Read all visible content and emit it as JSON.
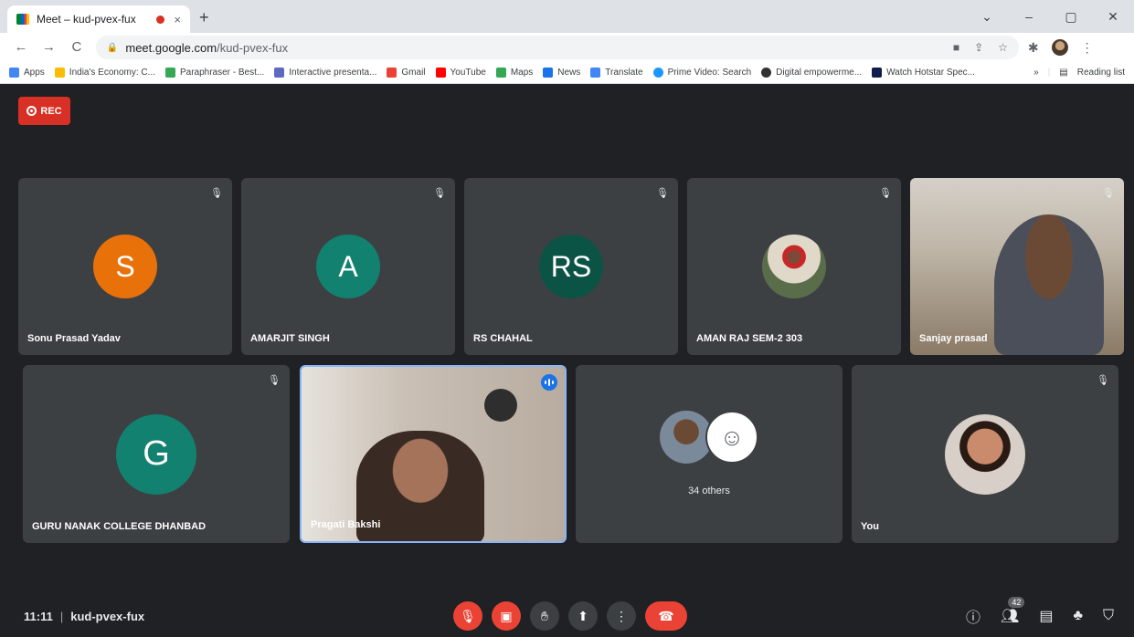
{
  "browser": {
    "tab_title": "Meet – kud-pvex-fux",
    "tab_close": "×",
    "new_tab": "+",
    "window_controls": [
      "⌄",
      "–",
      "▢",
      "✕"
    ],
    "nav": [
      "←",
      "→",
      "C"
    ],
    "url_host": "meet.google.com",
    "url_path": "/kud-pvex-fux",
    "bookmarks": [
      {
        "label": "Apps",
        "color": "#4285f4"
      },
      {
        "label": "India's Economy: C...",
        "color": "#fbbc04"
      },
      {
        "label": "Paraphraser - Best...",
        "color": "#34a853"
      },
      {
        "label": "Interactive presenta...",
        "color": "#5c6bc0"
      },
      {
        "label": "Gmail",
        "color": "#ea4335"
      },
      {
        "label": "YouTube",
        "color": "#ff0000"
      },
      {
        "label": "Maps",
        "color": "#34a853"
      },
      {
        "label": "News",
        "color": "#1a73e8"
      },
      {
        "label": "Translate",
        "color": "#4285f4"
      },
      {
        "label": "Prime Video: Search",
        "color": "#1a98ff"
      },
      {
        "label": "Digital empowerme...",
        "color": "#333333"
      },
      {
        "label": "Watch Hotstar Spec...",
        "color": "#0f1c4d"
      }
    ],
    "more": "»",
    "reading_list": "Reading list"
  },
  "meet": {
    "rec_label": "REC",
    "participants": [
      {
        "name": "Sonu Prasad Yadav",
        "initials": "S",
        "color": "#e8710a"
      },
      {
        "name": "AMARJIT SINGH",
        "initials": "A",
        "color": "#12816f"
      },
      {
        "name": "RS CHAHAL",
        "initials": "RS",
        "color": "#0b5345"
      },
      {
        "name": "AMAN RAJ SEM-2 303",
        "initials": "",
        "color": "#6d8f5a"
      },
      {
        "name": "Sanjay prasad",
        "initials": "",
        "color": "#8a7a66"
      },
      {
        "name": "GURU NANAK COLLEGE DHANBAD",
        "initials": "G",
        "color": "#12816f"
      },
      {
        "name": "Pragati Bakshi",
        "initials": "",
        "color": "#b8aca0"
      },
      {
        "name": "34 others",
        "initials": "",
        "color": "#3c4043"
      },
      {
        "name": "You",
        "initials": "",
        "color": "#c98b6b"
      }
    ],
    "time": "11:11",
    "meeting_code": "kud-pvex-fux",
    "participant_count": "42"
  }
}
